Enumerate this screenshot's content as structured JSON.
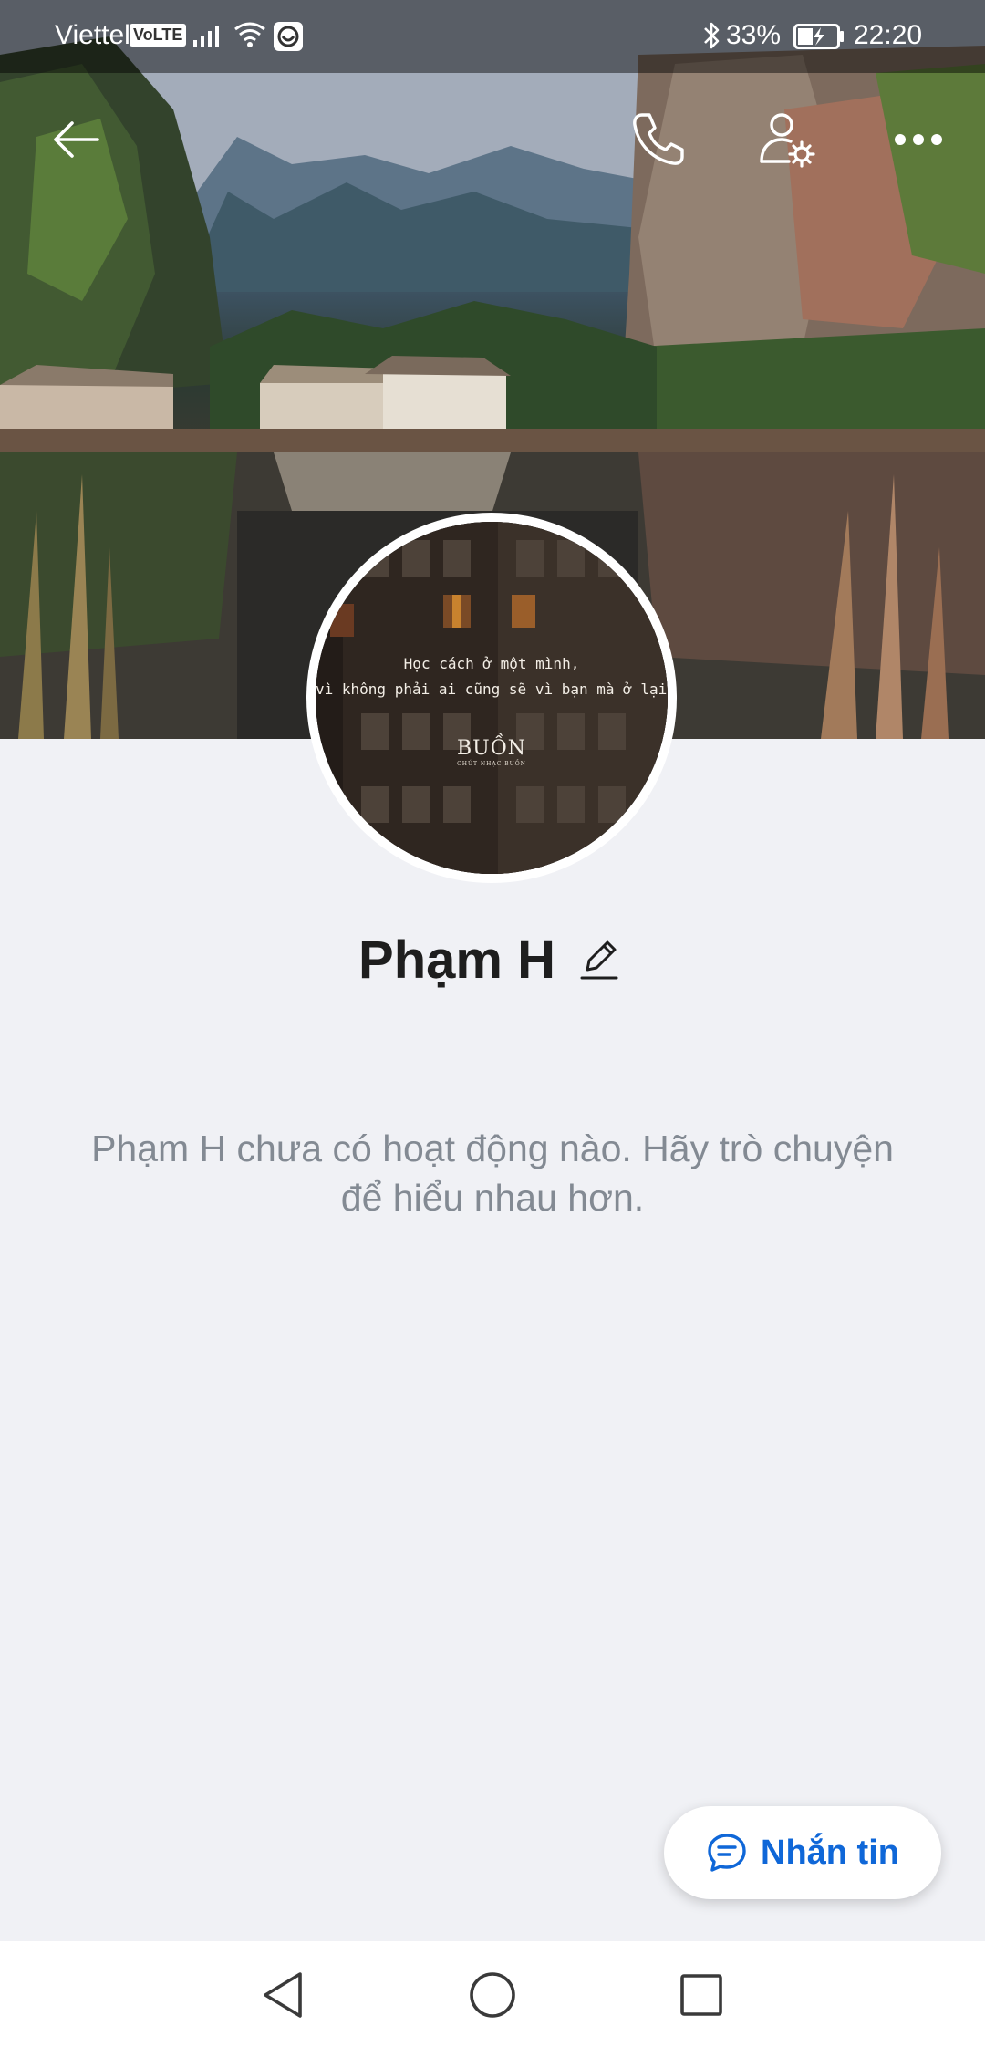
{
  "status_bar": {
    "carrier": "Viettel",
    "volte": "VoLTE",
    "battery_percent": "33%",
    "time": "22:20",
    "icons": [
      "signal-icon",
      "wifi-icon",
      "app-notification-icon",
      "bluetooth-icon",
      "battery-charging-icon"
    ]
  },
  "header": {
    "icons": [
      "back-arrow-icon",
      "phone-icon",
      "profile-settings-icon",
      "more-icon"
    ]
  },
  "avatar": {
    "quote_line1": "Học cách ở một mình,",
    "quote_line2": "vì không phải ai cũng sẽ vì bạn mà ở lại.",
    "logo": "BUỒN",
    "logo_sub": "CHÚT NHẠC BUỒN"
  },
  "profile": {
    "name": "Phạm H"
  },
  "empty_state": {
    "text": "Phạm H chưa có hoạt động nào. Hãy trò chuyện để hiểu nhau hơn."
  },
  "message_button": {
    "label": "Nhắn tin",
    "color": "#0f67d8"
  },
  "nav_bar": {
    "icons": [
      "nav-back-icon",
      "nav-home-icon",
      "nav-recents-icon"
    ]
  }
}
